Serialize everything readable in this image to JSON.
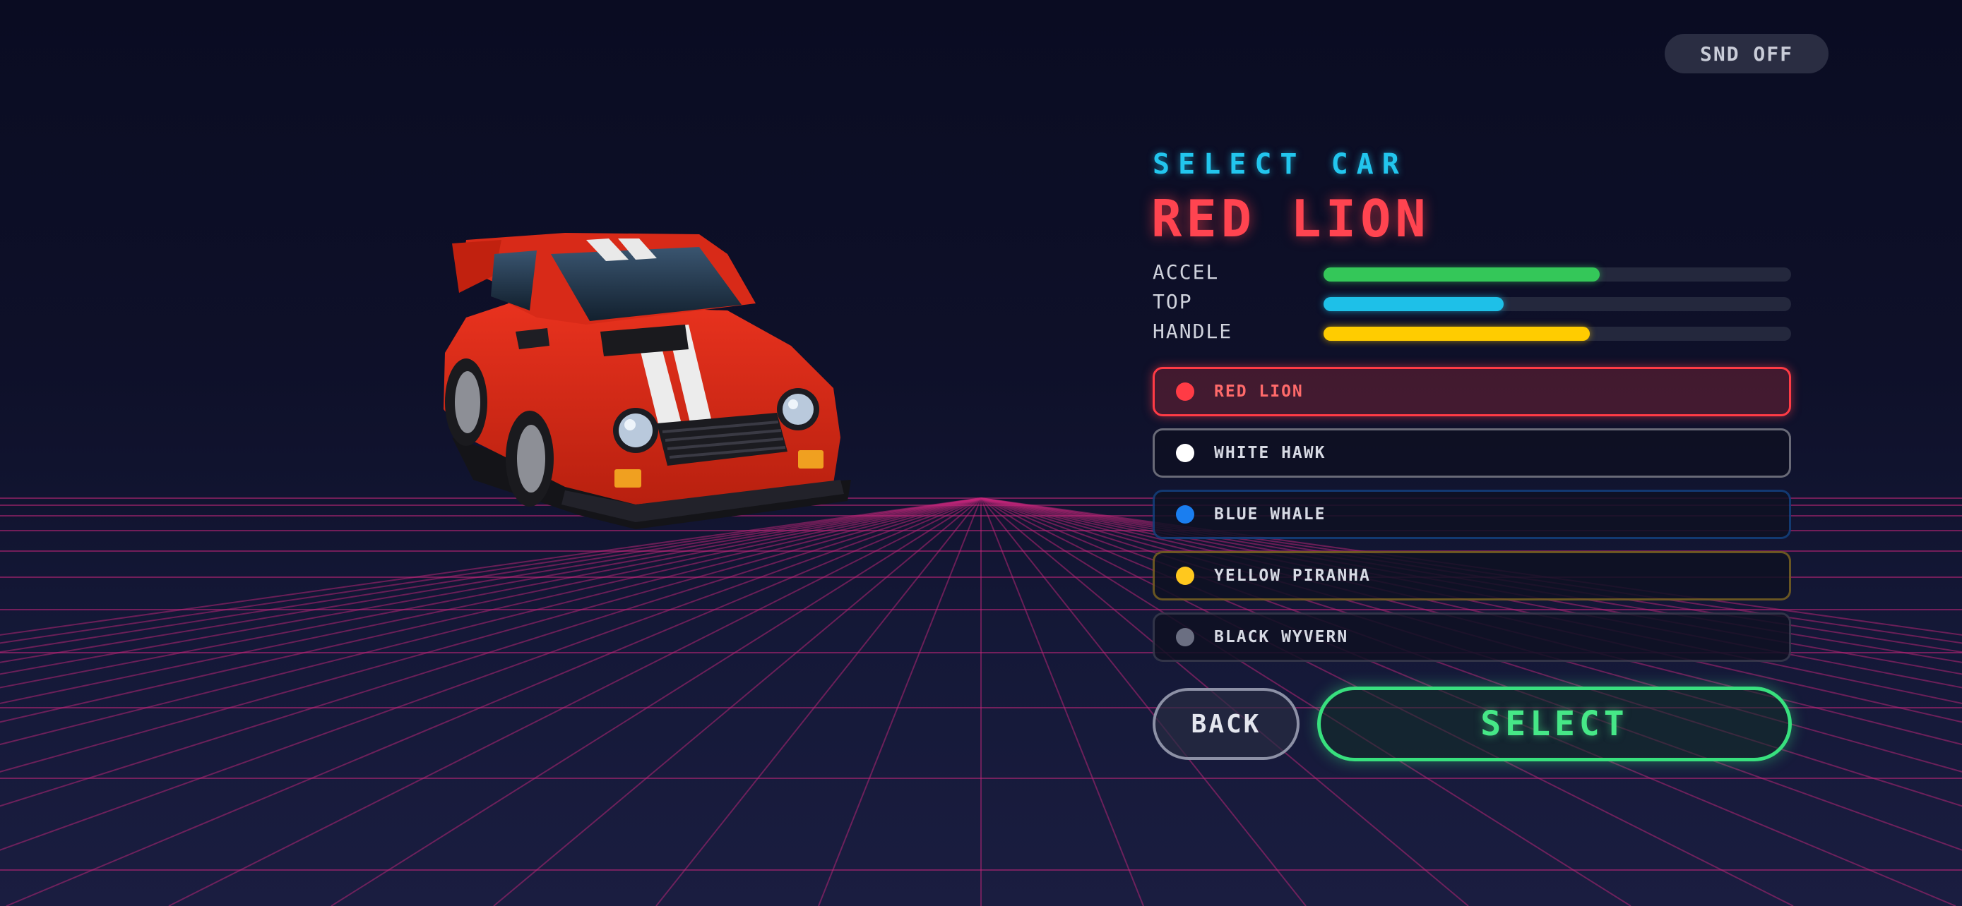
{
  "header": {
    "sound_toggle_label": "SND OFF"
  },
  "panel": {
    "title": "SELECT CAR",
    "selected_car_name": "RED LION",
    "stats": [
      {
        "label": "ACCEL",
        "value": 0.59,
        "color": "#34c759"
      },
      {
        "label": "TOP",
        "value": 0.385,
        "color": "#1ec0e8"
      },
      {
        "label": "HANDLE",
        "value": 0.57,
        "color": "#ffcc00"
      }
    ],
    "cars": [
      {
        "name": "RED LION",
        "color": "#ff3b45",
        "selected": true
      },
      {
        "name": "WHITE HAWK",
        "color": "#ffffff",
        "selected": false
      },
      {
        "name": "BLUE WHALE",
        "color": "#1a7ef0",
        "selected": false
      },
      {
        "name": "YELLOW PIRANHA",
        "color": "#ffc81e",
        "selected": false
      },
      {
        "name": "BLACK WYVERN",
        "color": "#6b6f82",
        "selected": false
      }
    ]
  },
  "buttons": {
    "back_label": "BACK",
    "select_label": "SELECT"
  },
  "colors": {
    "accent_cyan": "#22c6ee",
    "accent_red": "#ff4450",
    "accent_green": "#38e07e",
    "grid_magenta": "#c2267a"
  },
  "scene": {
    "car_preview": "red-car-3d-model"
  }
}
